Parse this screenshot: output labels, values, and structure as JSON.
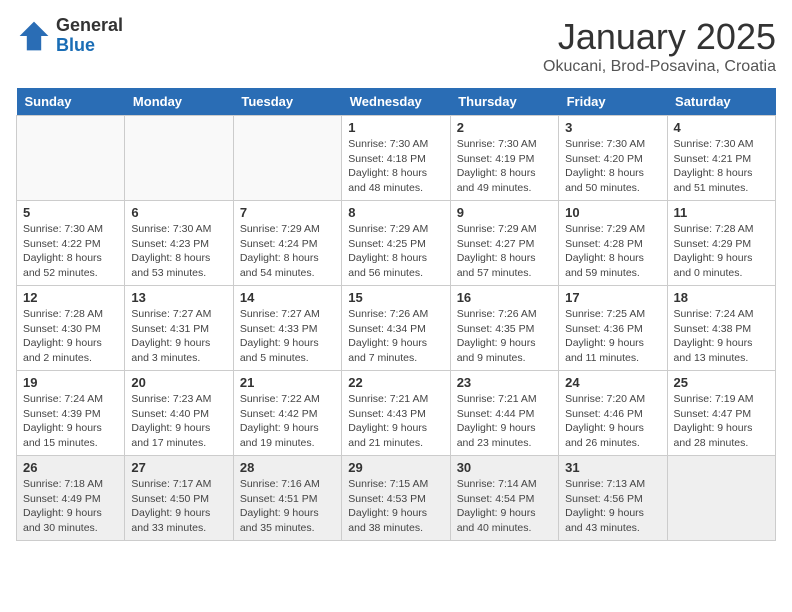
{
  "logo": {
    "general": "General",
    "blue": "Blue"
  },
  "title": {
    "month": "January 2025",
    "location": "Okucani, Brod-Posavina, Croatia"
  },
  "weekdays": [
    "Sunday",
    "Monday",
    "Tuesday",
    "Wednesday",
    "Thursday",
    "Friday",
    "Saturday"
  ],
  "weeks": [
    [
      {
        "day": "",
        "info": ""
      },
      {
        "day": "",
        "info": ""
      },
      {
        "day": "",
        "info": ""
      },
      {
        "day": "1",
        "info": "Sunrise: 7:30 AM\nSunset: 4:18 PM\nDaylight: 8 hours\nand 48 minutes."
      },
      {
        "day": "2",
        "info": "Sunrise: 7:30 AM\nSunset: 4:19 PM\nDaylight: 8 hours\nand 49 minutes."
      },
      {
        "day": "3",
        "info": "Sunrise: 7:30 AM\nSunset: 4:20 PM\nDaylight: 8 hours\nand 50 minutes."
      },
      {
        "day": "4",
        "info": "Sunrise: 7:30 AM\nSunset: 4:21 PM\nDaylight: 8 hours\nand 51 minutes."
      }
    ],
    [
      {
        "day": "5",
        "info": "Sunrise: 7:30 AM\nSunset: 4:22 PM\nDaylight: 8 hours\nand 52 minutes."
      },
      {
        "day": "6",
        "info": "Sunrise: 7:30 AM\nSunset: 4:23 PM\nDaylight: 8 hours\nand 53 minutes."
      },
      {
        "day": "7",
        "info": "Sunrise: 7:29 AM\nSunset: 4:24 PM\nDaylight: 8 hours\nand 54 minutes."
      },
      {
        "day": "8",
        "info": "Sunrise: 7:29 AM\nSunset: 4:25 PM\nDaylight: 8 hours\nand 56 minutes."
      },
      {
        "day": "9",
        "info": "Sunrise: 7:29 AM\nSunset: 4:27 PM\nDaylight: 8 hours\nand 57 minutes."
      },
      {
        "day": "10",
        "info": "Sunrise: 7:29 AM\nSunset: 4:28 PM\nDaylight: 8 hours\nand 59 minutes."
      },
      {
        "day": "11",
        "info": "Sunrise: 7:28 AM\nSunset: 4:29 PM\nDaylight: 9 hours\nand 0 minutes."
      }
    ],
    [
      {
        "day": "12",
        "info": "Sunrise: 7:28 AM\nSunset: 4:30 PM\nDaylight: 9 hours\nand 2 minutes."
      },
      {
        "day": "13",
        "info": "Sunrise: 7:27 AM\nSunset: 4:31 PM\nDaylight: 9 hours\nand 3 minutes."
      },
      {
        "day": "14",
        "info": "Sunrise: 7:27 AM\nSunset: 4:33 PM\nDaylight: 9 hours\nand 5 minutes."
      },
      {
        "day": "15",
        "info": "Sunrise: 7:26 AM\nSunset: 4:34 PM\nDaylight: 9 hours\nand 7 minutes."
      },
      {
        "day": "16",
        "info": "Sunrise: 7:26 AM\nSunset: 4:35 PM\nDaylight: 9 hours\nand 9 minutes."
      },
      {
        "day": "17",
        "info": "Sunrise: 7:25 AM\nSunset: 4:36 PM\nDaylight: 9 hours\nand 11 minutes."
      },
      {
        "day": "18",
        "info": "Sunrise: 7:24 AM\nSunset: 4:38 PM\nDaylight: 9 hours\nand 13 minutes."
      }
    ],
    [
      {
        "day": "19",
        "info": "Sunrise: 7:24 AM\nSunset: 4:39 PM\nDaylight: 9 hours\nand 15 minutes."
      },
      {
        "day": "20",
        "info": "Sunrise: 7:23 AM\nSunset: 4:40 PM\nDaylight: 9 hours\nand 17 minutes."
      },
      {
        "day": "21",
        "info": "Sunrise: 7:22 AM\nSunset: 4:42 PM\nDaylight: 9 hours\nand 19 minutes."
      },
      {
        "day": "22",
        "info": "Sunrise: 7:21 AM\nSunset: 4:43 PM\nDaylight: 9 hours\nand 21 minutes."
      },
      {
        "day": "23",
        "info": "Sunrise: 7:21 AM\nSunset: 4:44 PM\nDaylight: 9 hours\nand 23 minutes."
      },
      {
        "day": "24",
        "info": "Sunrise: 7:20 AM\nSunset: 4:46 PM\nDaylight: 9 hours\nand 26 minutes."
      },
      {
        "day": "25",
        "info": "Sunrise: 7:19 AM\nSunset: 4:47 PM\nDaylight: 9 hours\nand 28 minutes."
      }
    ],
    [
      {
        "day": "26",
        "info": "Sunrise: 7:18 AM\nSunset: 4:49 PM\nDaylight: 9 hours\nand 30 minutes."
      },
      {
        "day": "27",
        "info": "Sunrise: 7:17 AM\nSunset: 4:50 PM\nDaylight: 9 hours\nand 33 minutes."
      },
      {
        "day": "28",
        "info": "Sunrise: 7:16 AM\nSunset: 4:51 PM\nDaylight: 9 hours\nand 35 minutes."
      },
      {
        "day": "29",
        "info": "Sunrise: 7:15 AM\nSunset: 4:53 PM\nDaylight: 9 hours\nand 38 minutes."
      },
      {
        "day": "30",
        "info": "Sunrise: 7:14 AM\nSunset: 4:54 PM\nDaylight: 9 hours\nand 40 minutes."
      },
      {
        "day": "31",
        "info": "Sunrise: 7:13 AM\nSunset: 4:56 PM\nDaylight: 9 hours\nand 43 minutes."
      },
      {
        "day": "",
        "info": ""
      }
    ]
  ]
}
